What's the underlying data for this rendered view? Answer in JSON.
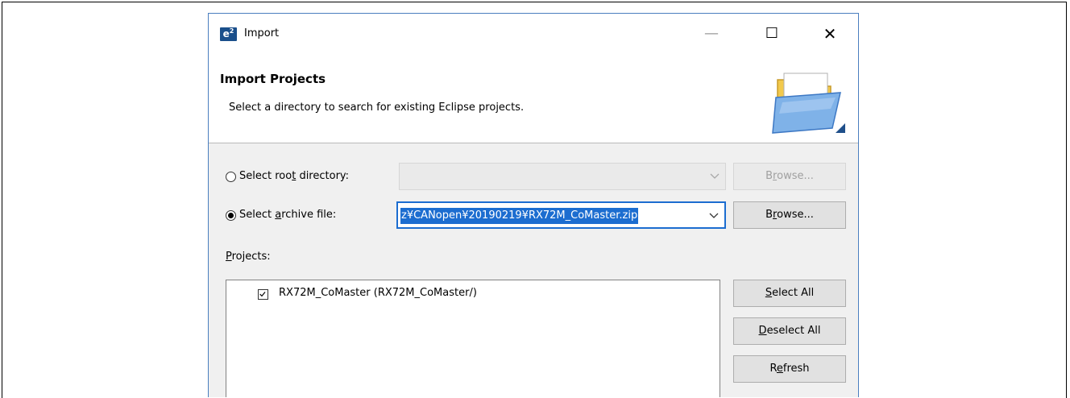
{
  "window": {
    "title": "Import",
    "app_icon_text": "e",
    "app_icon_sup": "2",
    "minimize_symbol": "—",
    "maximize_symbol": "☐",
    "close_symbol": "✕"
  },
  "banner": {
    "title": "Import Projects",
    "description": "Select a directory to search for existing Eclipse projects.",
    "icon": "folder-icon"
  },
  "root_directory": {
    "label_before": "Select roo",
    "label_mnemonic": "t",
    "label_after": " directory:",
    "selected": false,
    "value": "",
    "browse_before": "B",
    "browse_mnemonic": "r",
    "browse_after": "owse...",
    "enabled": false
  },
  "archive_file": {
    "label_before": "Select ",
    "label_mnemonic": "a",
    "label_after": "rchive file:",
    "selected": true,
    "value": "z¥CANopen¥20190219¥RX72M_CoMaster.zip",
    "browse_before": "B",
    "browse_mnemonic": "r",
    "browse_after": "owse...",
    "enabled": true
  },
  "projects": {
    "label_mnemonic": "P",
    "label_after": "rojects:",
    "items": [
      {
        "label": "RX72M_CoMaster (RX72M_CoMaster/)",
        "checked": true
      }
    ]
  },
  "actions": {
    "select_all": {
      "mnemonic": "S",
      "after": "elect All"
    },
    "deselect_all": {
      "mnemonic": "D",
      "after": "eselect All"
    },
    "refresh": {
      "before": "R",
      "mnemonic": "e",
      "after": "fresh"
    }
  },
  "colors": {
    "accent": "#1c6dd0",
    "dialog_background": "#f0f0f0",
    "button_face": "#e1e1e1"
  }
}
